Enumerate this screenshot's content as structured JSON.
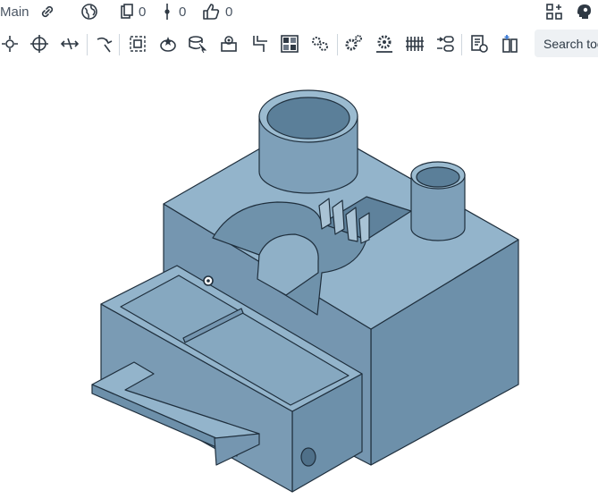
{
  "topbar": {
    "doc_label": "Main",
    "versions_count": "0",
    "branches_count": "0",
    "likes_count": "0"
  },
  "toolbar": {
    "search_placeholder": "Search tools"
  },
  "colors": {
    "part_top": "#93b4cb",
    "part_front": "#7b9db6",
    "part_side": "#6a8da7",
    "edge": "#1f2f3d",
    "icon": "#2f3944"
  }
}
